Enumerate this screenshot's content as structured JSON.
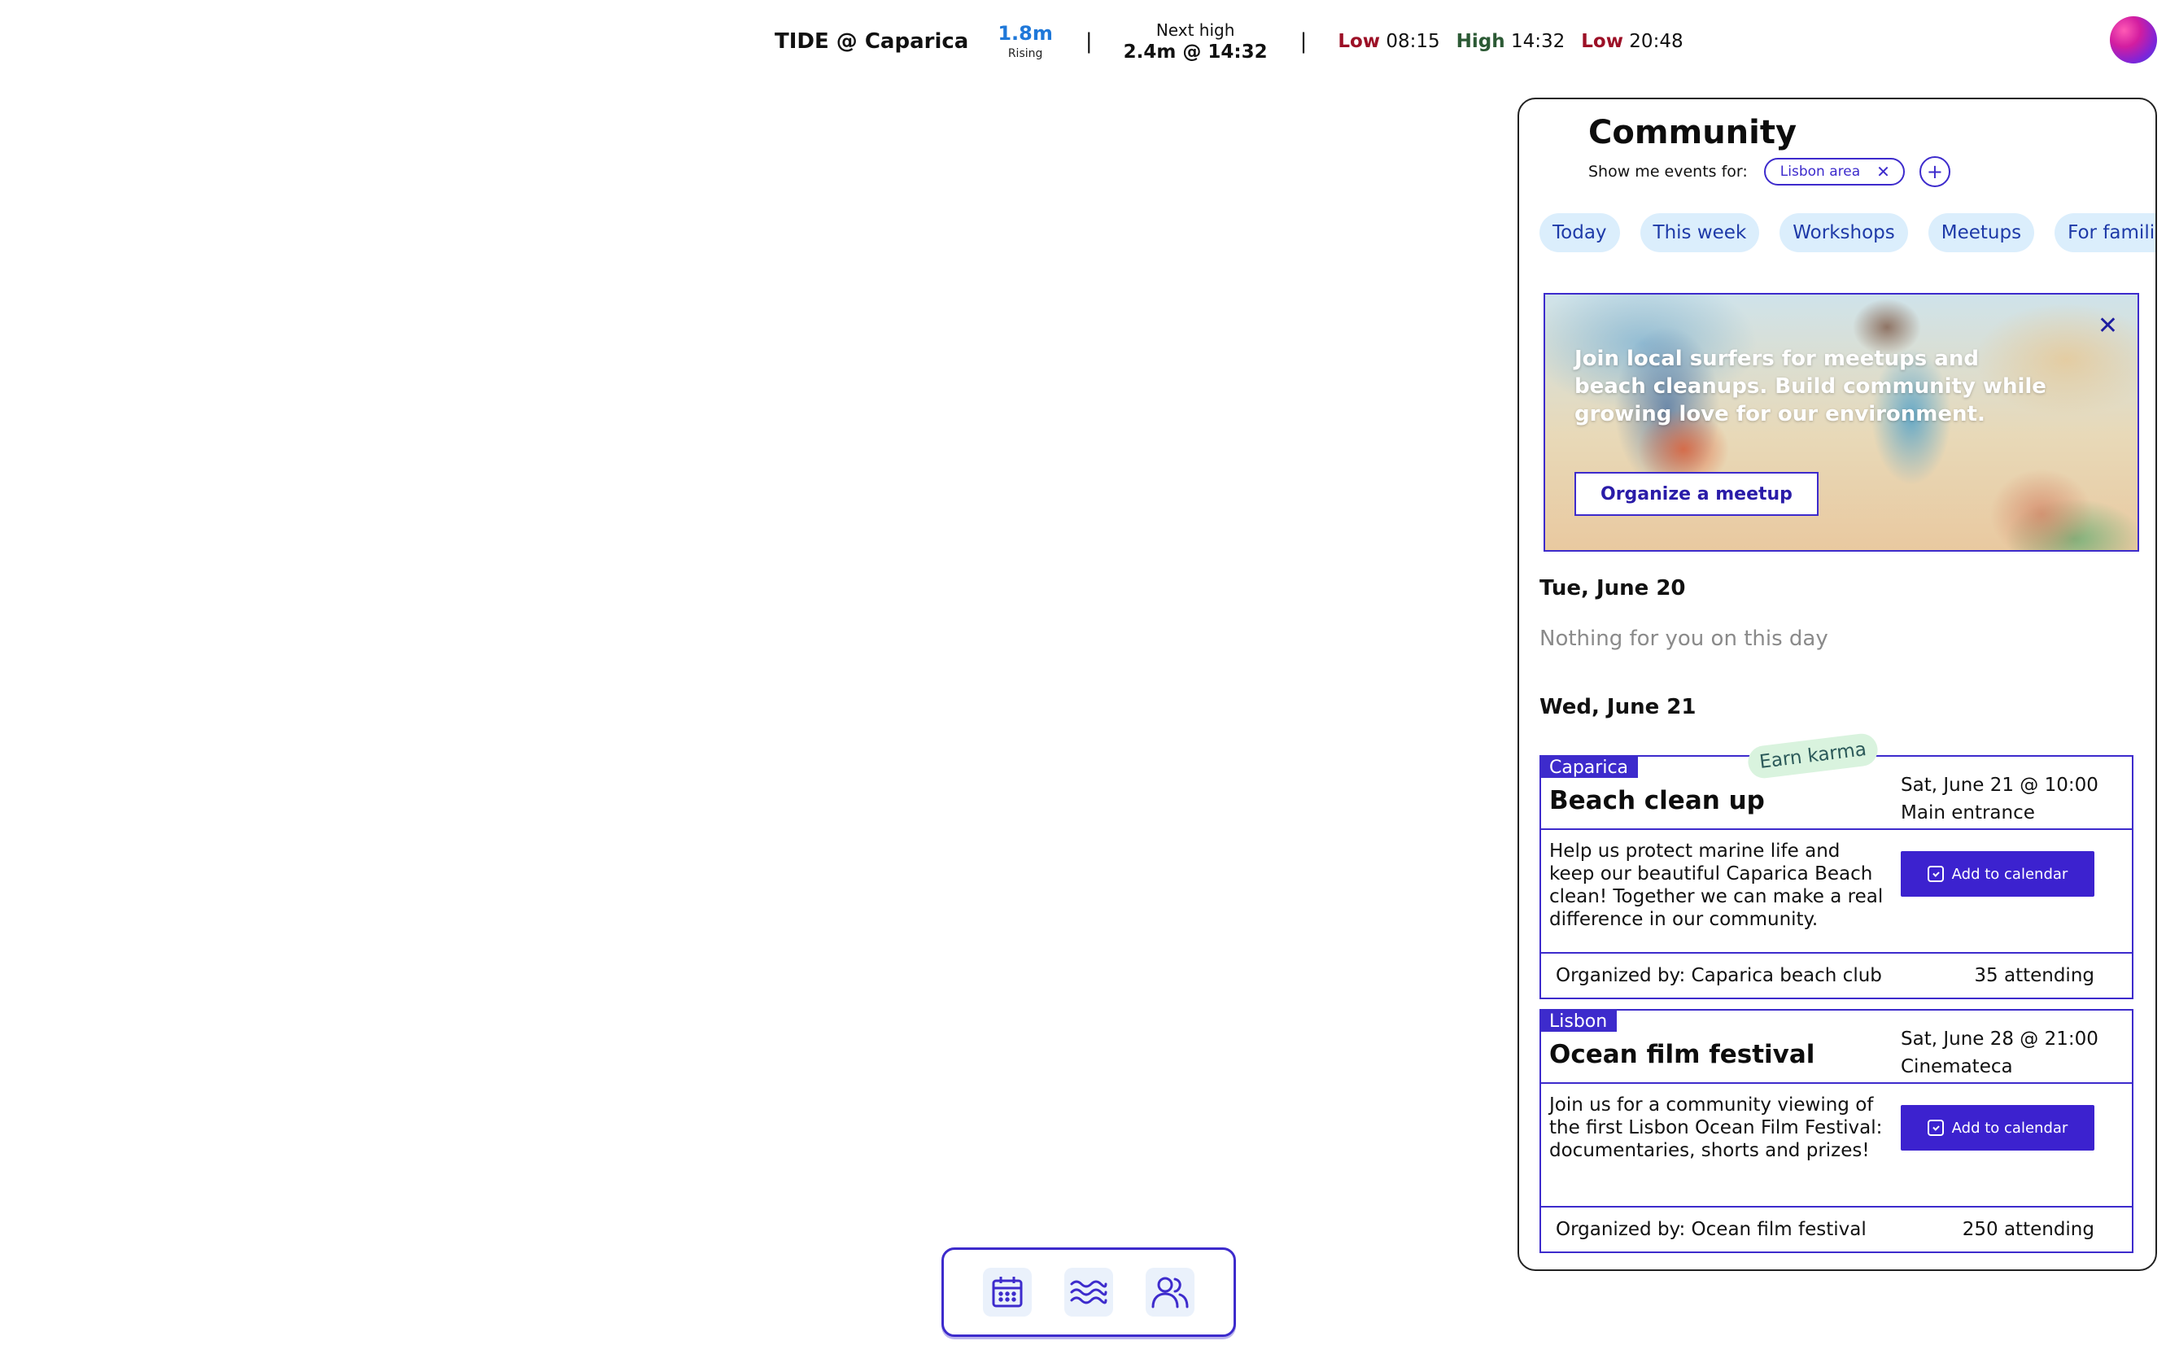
{
  "tide": {
    "title": "TIDE @ Caparica",
    "level": "1.8m",
    "trend": "Rising",
    "separator": "|",
    "next_high_label": "Next high",
    "next_high_value": "2.4m @ 14:32",
    "times": [
      {
        "label": "Low",
        "time": "08:15"
      },
      {
        "label": "High",
        "time": "14:32"
      },
      {
        "label": "Low",
        "time": "20:48"
      }
    ]
  },
  "community": {
    "title": "Community",
    "filter_label": "Show me events for:",
    "filter_chip": "Lisbon area",
    "chip_remove": "✕",
    "add_filter": "+",
    "pills": [
      "Today",
      "This week",
      "Workshops",
      "Meetups",
      "For families"
    ],
    "promo": {
      "text": "Join local surfers for meetups and beach cleanups. Build community while growing love for our environment.",
      "button": "Organize a meetup",
      "close": "✕"
    },
    "days": [
      {
        "date": "Tue, June 20",
        "empty_text": "Nothing for you on this day"
      },
      {
        "date": "Wed, June 21"
      }
    ],
    "events": [
      {
        "tag": "Caparica",
        "badge": "Earn karma",
        "title": "Beach clean up",
        "when": "Sat, June 21 @ 10:00",
        "where": "Main entrance",
        "description": "Help us protect marine life and keep our beautiful Caparica Beach clean! Together we can make a real difference in our community.",
        "button": "Add to calendar",
        "organizer": "Organized by: Caparica beach club",
        "attending": "35 attending"
      },
      {
        "tag": "Lisbon",
        "title": "Ocean film festival",
        "when": "Sat, June 28 @ 21:00",
        "where": "Cinemateca",
        "description": "Join us for a community viewing of the first Lisbon Ocean Film Festival: documentaries, shorts and prizes!",
        "button": "Add to calendar",
        "organizer": "Organized by: Ocean film festival",
        "attending": "250 attending"
      }
    ]
  },
  "nav": {
    "items": [
      {
        "icon": "calendar-icon"
      },
      {
        "icon": "waves-icon"
      },
      {
        "icon": "people-icon"
      }
    ]
  },
  "colors": {
    "accent": "#3d2bcc",
    "tide_level": "#1f78d9",
    "low_label": "#9c1026",
    "high_label": "#2c5a35",
    "pill_bg": "#dbeefc",
    "karma_bg": "#d9f3de"
  }
}
